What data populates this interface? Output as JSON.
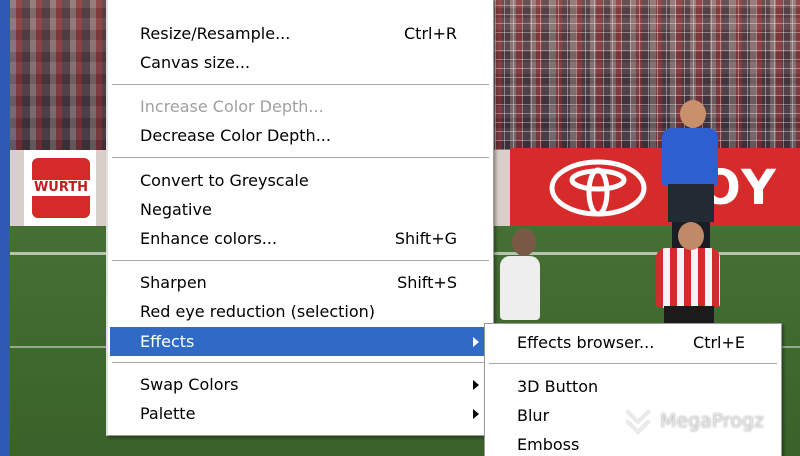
{
  "main_menu": {
    "items": [
      {
        "label": "Resize/Resample...",
        "shortcut": "Ctrl+R"
      },
      {
        "label": "Canvas size..."
      },
      {
        "label": "Increase Color Depth...",
        "disabled": true
      },
      {
        "label": "Decrease Color Depth..."
      },
      {
        "label": "Convert to Greyscale"
      },
      {
        "label": "Negative"
      },
      {
        "label": "Enhance colors...",
        "shortcut": "Shift+G"
      },
      {
        "label": "Sharpen",
        "shortcut": "Shift+S"
      },
      {
        "label": "Red eye reduction (selection)"
      },
      {
        "label": "Effects",
        "submenu": true,
        "active": true
      },
      {
        "label": "Swap Colors",
        "submenu": true
      },
      {
        "label": "Palette",
        "submenu": true
      }
    ]
  },
  "sub_menu": {
    "items": [
      {
        "label": "Effects browser...",
        "shortcut": "Ctrl+E"
      },
      {
        "label": "3D Button"
      },
      {
        "label": "Blur"
      },
      {
        "label": "Emboss"
      }
    ]
  },
  "background": {
    "ad_left_text": "WURTH",
    "ad_right_text": "OY"
  },
  "watermark": {
    "text": "MegaProgz"
  },
  "colors": {
    "highlight": "#316ac5",
    "menu_bg": "#ffffff",
    "disabled_text": "#a0a0a0"
  }
}
